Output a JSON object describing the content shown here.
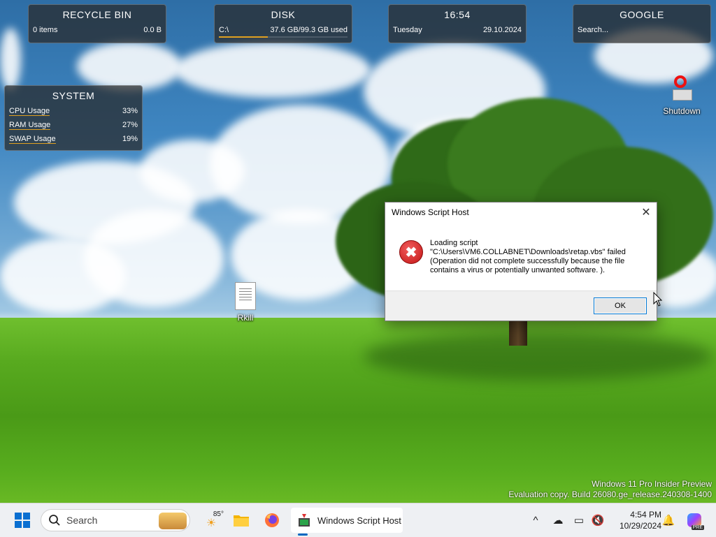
{
  "widgets": {
    "recycle_bin": {
      "title": "RECYCLE BIN",
      "items": "0 items",
      "size": "0.0 B"
    },
    "disk": {
      "title": "DISK",
      "drive": "C:\\",
      "usage": "37.6 GB/99.3 GB used",
      "used_fraction": 0.379
    },
    "clock": {
      "time": "16:54",
      "day": "Tuesday",
      "date": "29.10.2024"
    },
    "google": {
      "title": "GOOGLE",
      "placeholder": "Search..."
    },
    "system": {
      "title": "SYSTEM",
      "rows": [
        {
          "label": "CPU Usage",
          "value": "33%"
        },
        {
          "label": "RAM Usage",
          "value": "27%"
        },
        {
          "label": "SWAP Usage",
          "value": "19%"
        }
      ]
    }
  },
  "desktop_icons": {
    "shutdown": "Shutdown",
    "rkill": "Rkill"
  },
  "watermark": {
    "line1": "Windows 11 Pro Insider Preview",
    "line2": "Evaluation copy. Build 26080.ge_release.240308-1400"
  },
  "dialog": {
    "title": "Windows Script Host",
    "close_glyph": "✕",
    "error_glyph": "✖",
    "message_line1": "Loading script",
    "message_line2": "\"C:\\Users\\VM6.COLLABNET\\Downloads\\retap.vbs\" failed",
    "message_line3": "(Operation did not complete successfully because the file",
    "message_line4": "contains a virus or potentially unwanted software. ).",
    "ok_label": "OK"
  },
  "taskbar": {
    "search_placeholder": "Search",
    "weather_temp": "85°",
    "active_app_label": "Windows Script Host",
    "time": "4:54 PM",
    "date": "10/29/2024",
    "copilot_badge": "PRE"
  },
  "icons": {
    "start": "windows-start-icon",
    "search": "search-icon",
    "weather": "weather-icon",
    "explorer": "file-explorer-icon",
    "firefox": "firefox-icon",
    "script_host": "script-host-icon",
    "chevron": "chevron-up-icon",
    "onedrive": "onedrive-icon",
    "network": "network-icon",
    "volume": "volume-icon",
    "notification": "notification-bell-icon",
    "copilot": "copilot-icon"
  },
  "colors": {
    "accent": "#0067c0",
    "error": "#c21414",
    "disk_bar": "#e0a020"
  }
}
